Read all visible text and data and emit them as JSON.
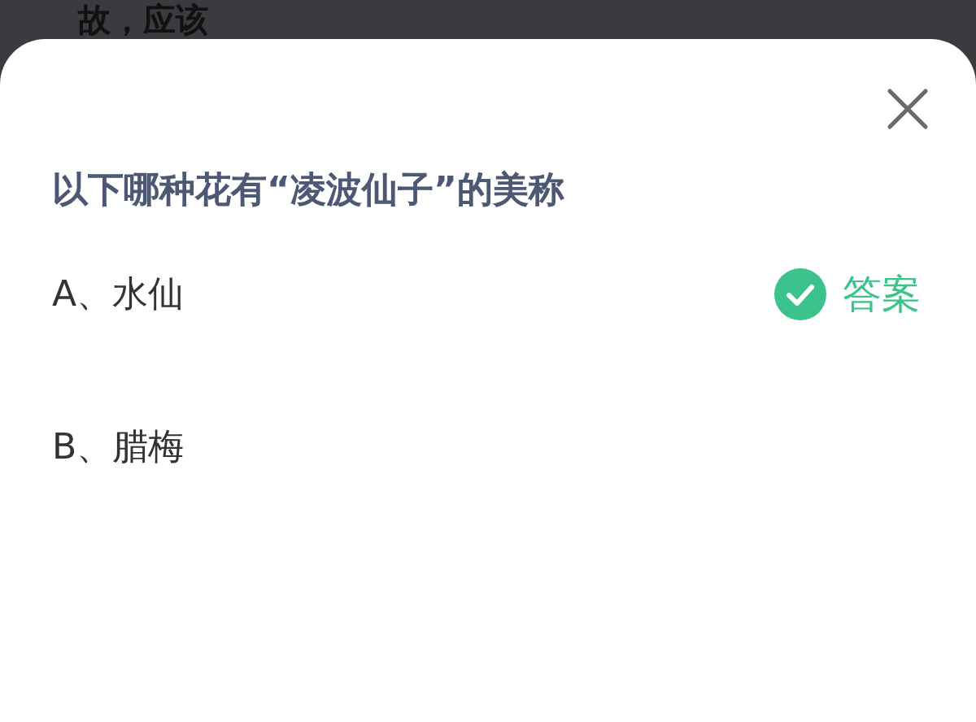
{
  "background": {
    "text": "故，应该"
  },
  "sheet": {
    "question": "以下哪种花有“凌波仙子”的美称",
    "answer_label": "答案",
    "options": [
      {
        "label": "A、水仙",
        "correct": true
      },
      {
        "label": "B、腊梅",
        "correct": false
      }
    ]
  }
}
